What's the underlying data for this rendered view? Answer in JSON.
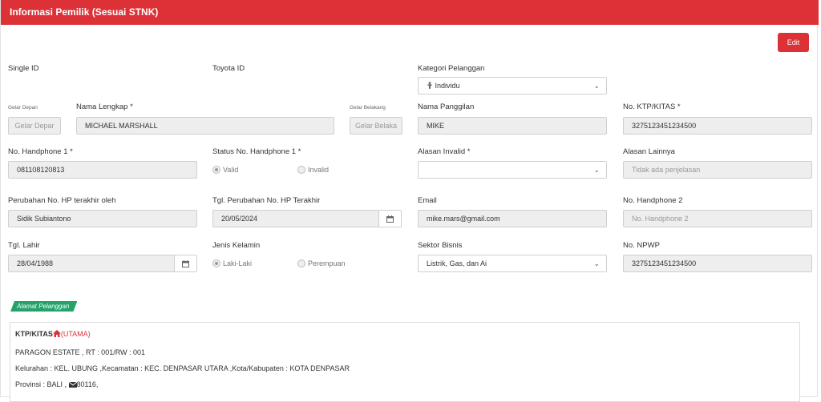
{
  "header": {
    "title": "Informasi Pemilik (Sesuai STNK)"
  },
  "actions": {
    "edit_label": "Edit"
  },
  "fields": {
    "single_id": {
      "label": "Single ID"
    },
    "toyota_id": {
      "label": "Toyota ID"
    },
    "kategori": {
      "label": "Kategori Pelanggan",
      "value": "Individu",
      "icon": "person-icon"
    },
    "gelar_depan": {
      "label": "Gelar Depan",
      "placeholder": "Gelar Depar"
    },
    "nama_lengkap": {
      "label": "Nama Lengkap *",
      "value": "MICHAEL MARSHALL"
    },
    "gelar_belakang": {
      "label": "Gelar Belakang",
      "placeholder": "Gelar Belaka"
    },
    "nama_panggilan": {
      "label": "Nama Panggilan",
      "value": "MIKE"
    },
    "ktp": {
      "label": "No. KTP/KITAS *",
      "value": "3275123451234500"
    },
    "hp1": {
      "label": "No. Handphone 1 *",
      "value": "081108120813"
    },
    "status_hp1": {
      "label": "Status No. Handphone 1 *",
      "options": [
        "Valid",
        "Invalid"
      ],
      "selected": "Valid"
    },
    "alasan_invalid": {
      "label": "Alasan Invalid *",
      "value": ""
    },
    "alasan_lainnya": {
      "label": "Alasan Lainnya",
      "placeholder": "Tidak ada penjelasan"
    },
    "perubahan_hp_oleh": {
      "label": "Perubahan No. HP terakhir oleh",
      "value": "Sidik Subiantono"
    },
    "tgl_perubahan_hp": {
      "label": "Tgl. Perubahan No. HP Terakhir",
      "value": "20/05/2024"
    },
    "email": {
      "label": "Email",
      "value": "mike.mars@gmail.com"
    },
    "hp2": {
      "label": "No. Handphone 2",
      "placeholder": "No. Handphone 2"
    },
    "tgl_lahir": {
      "label": "Tgl. Lahir",
      "value": "28/04/1988"
    },
    "jenis_kelamin": {
      "label": "Jenis Kelamin",
      "options": [
        "Laki-Laki",
        "Perempuan"
      ],
      "selected": "Laki-Laki"
    },
    "sektor_bisnis": {
      "label": "Sektor Bisnis",
      "value": "Listrik, Gas, dan Ai"
    },
    "npwp": {
      "label": "No. NPWP",
      "value": "3275123451234500"
    }
  },
  "address": {
    "section_label": "Alamat Pelanggan",
    "type": "KTP/KITAS",
    "tag": "(UTAMA)",
    "line1": "PARAGON ESTATE , RT : 001/RW : 001",
    "line2": "Kelurahan : KEL. UBUNG ,Kecamatan : KEC. DENPASAR UTARA ,Kota/Kabupaten : KOTA DENPASAR",
    "line3_prefix": "Provinsi : BALI ,",
    "line3_postal": "80116,"
  },
  "colors": {
    "brand": "#dc3237",
    "section": "#23a26a",
    "field_bg": "#eeeeee",
    "border": "#cfcfcf"
  }
}
